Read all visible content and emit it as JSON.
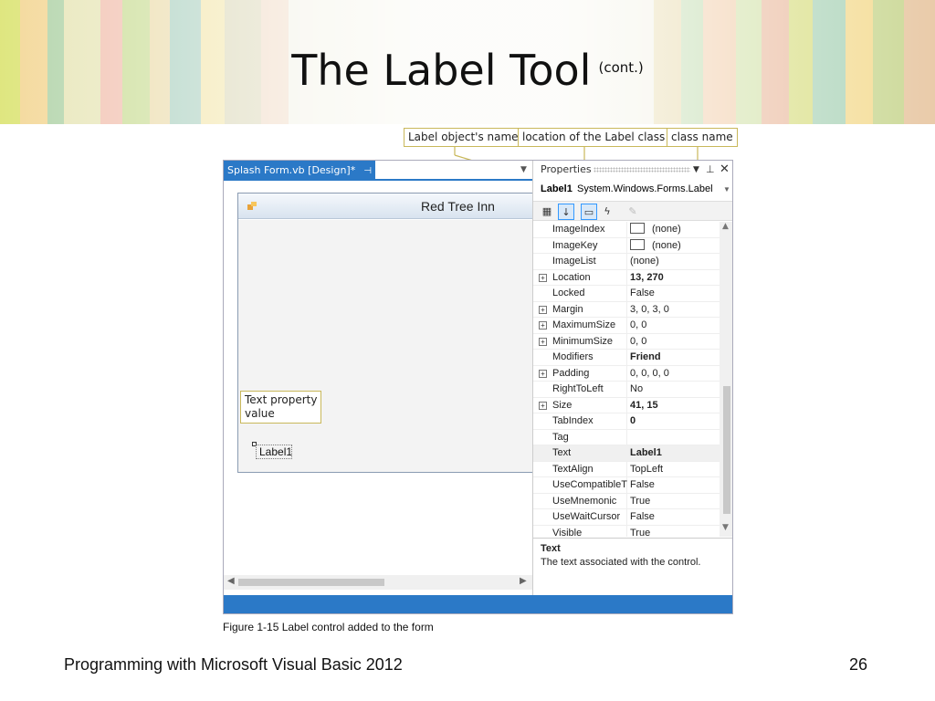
{
  "slide": {
    "title": "The Label Tool",
    "title_suffix": "(cont.)",
    "caption": "Figure 1-15 Label control added to the form",
    "footer_left": "Programming with Microsoft Visual Basic 2012",
    "page_number": "26"
  },
  "callouts": {
    "object_name": "Label object's name",
    "class_location": "location of the Label class",
    "class_name": "class name",
    "text_property": "Text property\nvalue"
  },
  "ide": {
    "design_tab": {
      "label": "Splash Form.vb [Design]*",
      "pin_icon": "pin-icon",
      "close_icon": "close-icon"
    },
    "form": {
      "title": "Red Tree Inn",
      "label_control_text": "Label1"
    },
    "properties": {
      "title": "Properties",
      "object_name": "Label1",
      "object_class": "System.Windows.Forms.Label",
      "rows": [
        {
          "name": "ImageIndex",
          "value": "(none)",
          "swatch": true,
          "expandable": false,
          "bold": false
        },
        {
          "name": "ImageKey",
          "value": "(none)",
          "swatch": true,
          "expandable": false,
          "bold": false
        },
        {
          "name": "ImageList",
          "value": "(none)",
          "swatch": false,
          "expandable": false,
          "bold": false
        },
        {
          "name": "Location",
          "value": "13, 270",
          "swatch": false,
          "expandable": true,
          "bold": true
        },
        {
          "name": "Locked",
          "value": "False",
          "swatch": false,
          "expandable": false,
          "bold": false
        },
        {
          "name": "Margin",
          "value": "3, 0, 3, 0",
          "swatch": false,
          "expandable": true,
          "bold": false
        },
        {
          "name": "MaximumSize",
          "value": "0, 0",
          "swatch": false,
          "expandable": true,
          "bold": false
        },
        {
          "name": "MinimumSize",
          "value": "0, 0",
          "swatch": false,
          "expandable": true,
          "bold": false
        },
        {
          "name": "Modifiers",
          "value": "Friend",
          "swatch": false,
          "expandable": false,
          "bold": true
        },
        {
          "name": "Padding",
          "value": "0, 0, 0, 0",
          "swatch": false,
          "expandable": true,
          "bold": false
        },
        {
          "name": "RightToLeft",
          "value": "No",
          "swatch": false,
          "expandable": false,
          "bold": false
        },
        {
          "name": "Size",
          "value": "41, 15",
          "swatch": false,
          "expandable": true,
          "bold": true
        },
        {
          "name": "TabIndex",
          "value": "0",
          "swatch": false,
          "expandable": false,
          "bold": true
        },
        {
          "name": "Tag",
          "value": "",
          "swatch": false,
          "expandable": false,
          "bold": false
        },
        {
          "name": "Text",
          "value": "Label1",
          "swatch": false,
          "expandable": false,
          "bold": true,
          "selected": true
        },
        {
          "name": "TextAlign",
          "value": "TopLeft",
          "swatch": false,
          "expandable": false,
          "bold": false
        },
        {
          "name": "UseCompatibleT",
          "value": "False",
          "swatch": false,
          "expandable": false,
          "bold": false
        },
        {
          "name": "UseMnemonic",
          "value": "True",
          "swatch": false,
          "expandable": false,
          "bold": false
        },
        {
          "name": "UseWaitCursor",
          "value": "False",
          "swatch": false,
          "expandable": false,
          "bold": false
        },
        {
          "name": "Visible",
          "value": "True",
          "swatch": false,
          "expandable": false,
          "bold": false
        }
      ],
      "description_title": "Text",
      "description_text": "The text associated with the control."
    }
  },
  "colors": {
    "accent_blue": "#2b79c7",
    "callout_border": "#c9b85a"
  }
}
